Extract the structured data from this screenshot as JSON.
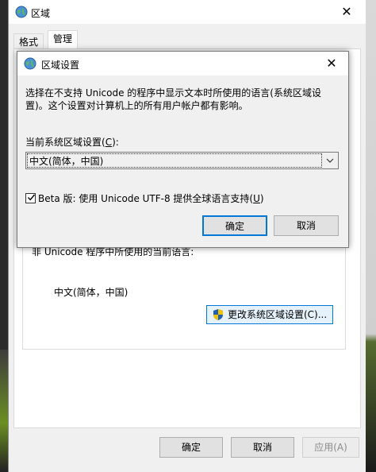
{
  "outer_window": {
    "title": "区域",
    "tabs": [
      {
        "label": "格式"
      },
      {
        "label": "管理"
      }
    ],
    "nonunicode_label": "非 Unicode 程序中所使用的当前语言:",
    "current_language": "中文(简体，中国)",
    "change_button": "更改系统区域设置(C)...",
    "ok_label": "确定",
    "cancel_label": "取消",
    "apply_label": "应用(A)"
  },
  "dialog": {
    "title": "区域设置",
    "description": "选择在不支持 Unicode 的程序中显示文本时所使用的语言(系统区域设置)。这个设置对计算机上的所有用户帐户都有影响。",
    "current_locale_label": "当前系统区域设置(",
    "current_locale_accel": "C",
    "current_locale_suffix": "):",
    "selected_locale": "中文(简体，中国)",
    "beta_label": "Beta 版: 使用 Unicode UTF-8 提供全球语言支持(",
    "beta_accel": "U",
    "beta_suffix": ")",
    "beta_checked": true,
    "ok_label": "确定",
    "cancel_label": "取消"
  },
  "colors": {
    "accent": "#0078d7",
    "dialog_bg": "#f0f0f0"
  }
}
